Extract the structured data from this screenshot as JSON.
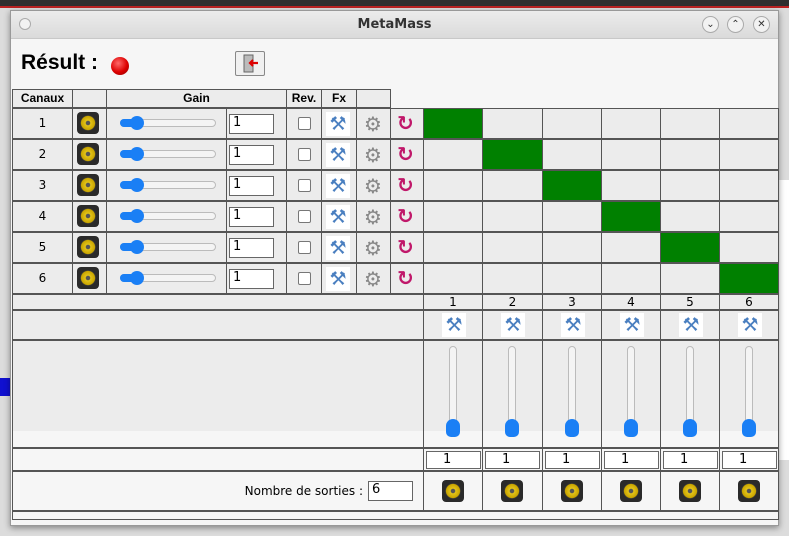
{
  "window": {
    "title": "MetaMass",
    "buttons": [
      "minimize",
      "maximize",
      "close"
    ]
  },
  "result": {
    "label": "Résult :",
    "status_color": "#dd0000"
  },
  "header": {
    "canaux": "Canaux",
    "gain": "Gain",
    "rev": "Rev.",
    "fx": "Fx"
  },
  "channels": [
    {
      "label": "1",
      "gain": "1",
      "gain_slider": 0.1,
      "rev": false,
      "route": 1
    },
    {
      "label": "2",
      "gain": "1",
      "gain_slider": 0.1,
      "rev": false,
      "route": 2
    },
    {
      "label": "3",
      "gain": "1",
      "gain_slider": 0.1,
      "rev": false,
      "route": 3
    },
    {
      "label": "4",
      "gain": "1",
      "gain_slider": 0.1,
      "rev": false,
      "route": 4
    },
    {
      "label": "5",
      "gain": "1",
      "gain_slider": 0.1,
      "rev": false,
      "route": 5
    },
    {
      "label": "6",
      "gain": "1",
      "gain_slider": 0.1,
      "rev": false,
      "route": 6
    }
  ],
  "outputs": [
    {
      "label": "1",
      "value": "1",
      "slider": 0.0
    },
    {
      "label": "2",
      "value": "1",
      "slider": 0.0
    },
    {
      "label": "3",
      "value": "1",
      "slider": 0.0
    },
    {
      "label": "4",
      "value": "1",
      "slider": 0.0
    },
    {
      "label": "5",
      "value": "1",
      "slider": 0.0
    },
    {
      "label": "6",
      "value": "1",
      "slider": 0.0
    }
  ],
  "nombre_sorties": {
    "label": "Nombre de sorties :",
    "value": "6"
  },
  "colors": {
    "route_active": "#008000",
    "accent": "#1a7ff5",
    "reset": "#c0186a"
  },
  "icons": {
    "speaker": "speaker-icon",
    "tools": "tools-icon",
    "gear": "gear-icon",
    "reset": "reset-icon",
    "exit": "exit-door-icon"
  }
}
